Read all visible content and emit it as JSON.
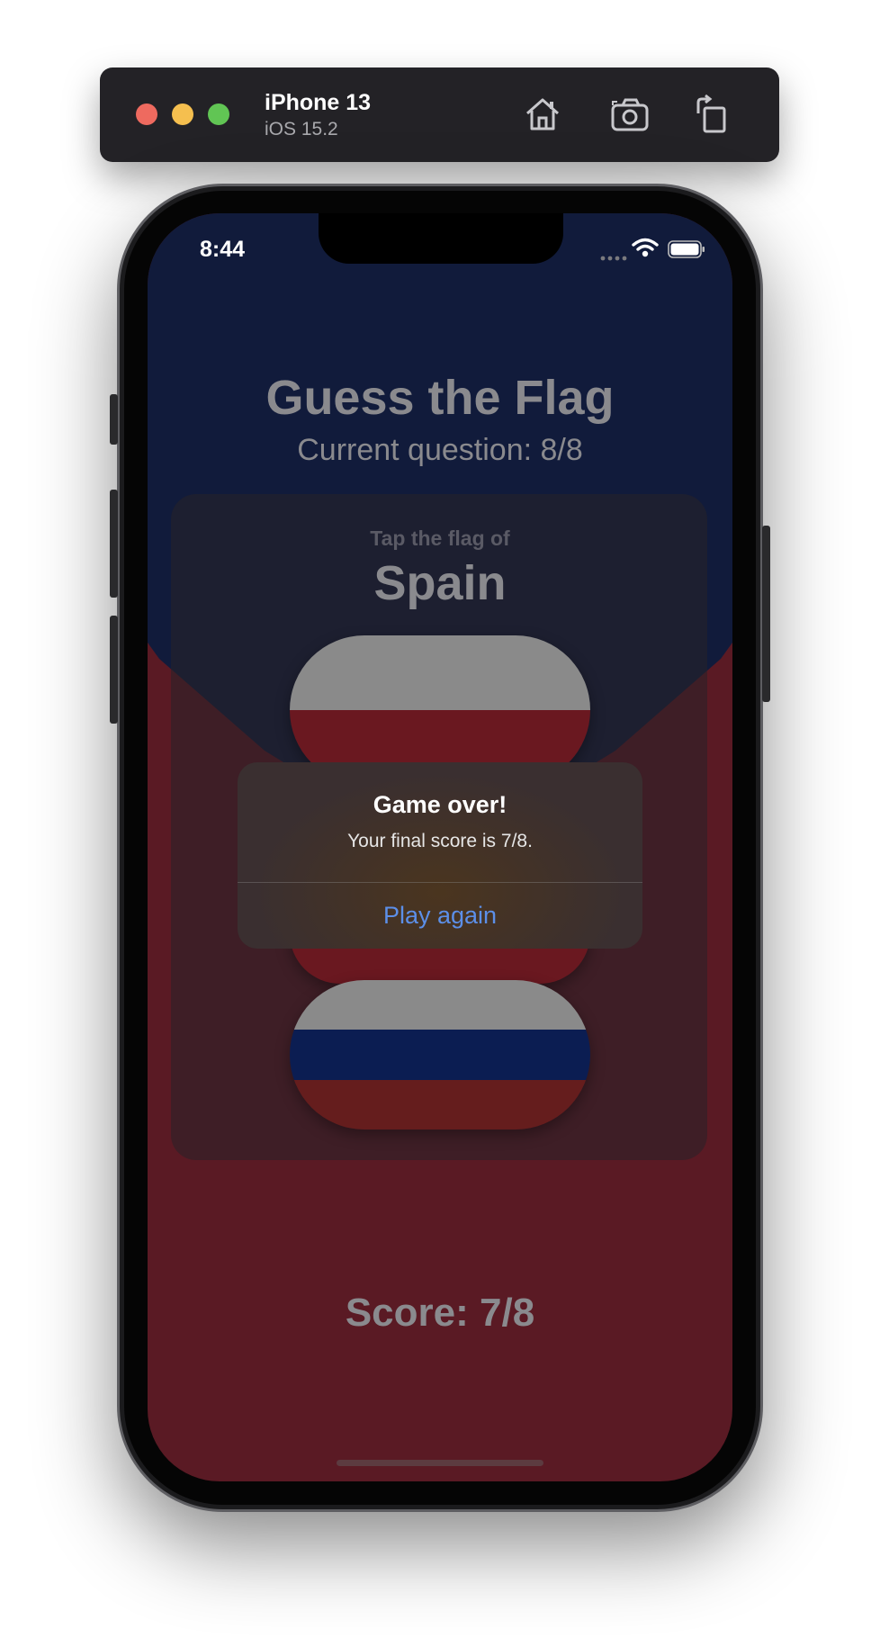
{
  "simulator": {
    "device_name": "iPhone 13",
    "os_version": "iOS 15.2",
    "toolbar_icons": [
      "home-icon",
      "screenshot-icon",
      "rotate-icon"
    ]
  },
  "status_bar": {
    "time": "8:44",
    "icons": [
      "cellular-icon",
      "wifi-icon",
      "battery-icon"
    ]
  },
  "app": {
    "title": "Guess the Flag",
    "question_progress": "Current question: 8/8",
    "prompt_label": "Tap the flag of",
    "country": "Spain",
    "score": "Score: 7/8",
    "flags": [
      {
        "name": "Poland",
        "stripes": [
          "#8a8a8a",
          "#6a1820"
        ]
      },
      {
        "name": "Partially hidden flag",
        "stripes": [
          "#6a1820"
        ]
      },
      {
        "name": "Russia",
        "stripes": [
          "#8a8a8a",
          "#0b1d52",
          "#651d1d"
        ]
      }
    ]
  },
  "alert": {
    "title": "Game over!",
    "message": "Your final score is 7/8.",
    "button_label": "Play again"
  },
  "colors": {
    "background_top": "#111b3b",
    "background_bottom": "#5a1a24",
    "alert_accent": "#5c8fe8"
  }
}
